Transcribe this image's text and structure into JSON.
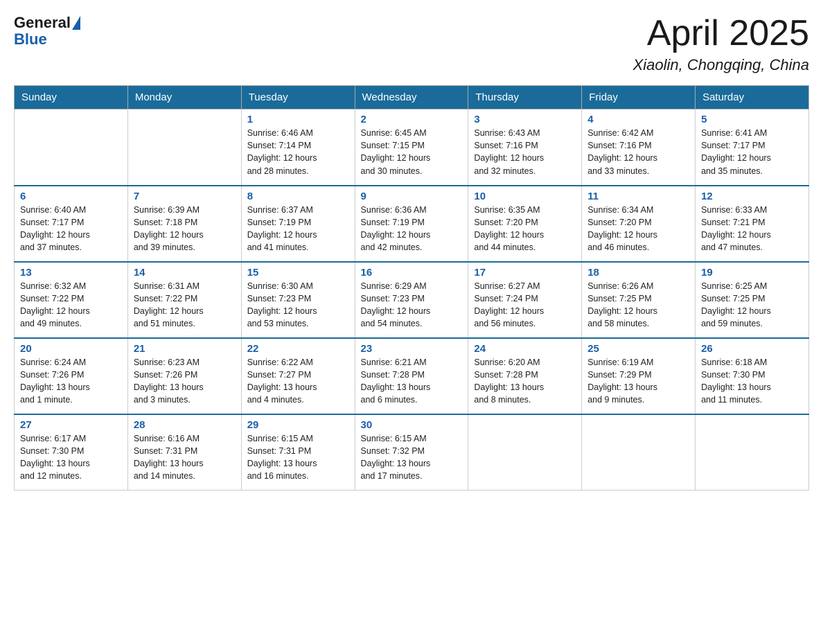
{
  "logo": {
    "general": "General",
    "blue": "Blue"
  },
  "title": {
    "month_year": "April 2025",
    "location": "Xiaolin, Chongqing, China"
  },
  "weekdays": [
    "Sunday",
    "Monday",
    "Tuesday",
    "Wednesday",
    "Thursday",
    "Friday",
    "Saturday"
  ],
  "weeks": [
    [
      {
        "day": "",
        "info": ""
      },
      {
        "day": "",
        "info": ""
      },
      {
        "day": "1",
        "info": "Sunrise: 6:46 AM\nSunset: 7:14 PM\nDaylight: 12 hours\nand 28 minutes."
      },
      {
        "day": "2",
        "info": "Sunrise: 6:45 AM\nSunset: 7:15 PM\nDaylight: 12 hours\nand 30 minutes."
      },
      {
        "day": "3",
        "info": "Sunrise: 6:43 AM\nSunset: 7:16 PM\nDaylight: 12 hours\nand 32 minutes."
      },
      {
        "day": "4",
        "info": "Sunrise: 6:42 AM\nSunset: 7:16 PM\nDaylight: 12 hours\nand 33 minutes."
      },
      {
        "day": "5",
        "info": "Sunrise: 6:41 AM\nSunset: 7:17 PM\nDaylight: 12 hours\nand 35 minutes."
      }
    ],
    [
      {
        "day": "6",
        "info": "Sunrise: 6:40 AM\nSunset: 7:17 PM\nDaylight: 12 hours\nand 37 minutes."
      },
      {
        "day": "7",
        "info": "Sunrise: 6:39 AM\nSunset: 7:18 PM\nDaylight: 12 hours\nand 39 minutes."
      },
      {
        "day": "8",
        "info": "Sunrise: 6:37 AM\nSunset: 7:19 PM\nDaylight: 12 hours\nand 41 minutes."
      },
      {
        "day": "9",
        "info": "Sunrise: 6:36 AM\nSunset: 7:19 PM\nDaylight: 12 hours\nand 42 minutes."
      },
      {
        "day": "10",
        "info": "Sunrise: 6:35 AM\nSunset: 7:20 PM\nDaylight: 12 hours\nand 44 minutes."
      },
      {
        "day": "11",
        "info": "Sunrise: 6:34 AM\nSunset: 7:20 PM\nDaylight: 12 hours\nand 46 minutes."
      },
      {
        "day": "12",
        "info": "Sunrise: 6:33 AM\nSunset: 7:21 PM\nDaylight: 12 hours\nand 47 minutes."
      }
    ],
    [
      {
        "day": "13",
        "info": "Sunrise: 6:32 AM\nSunset: 7:22 PM\nDaylight: 12 hours\nand 49 minutes."
      },
      {
        "day": "14",
        "info": "Sunrise: 6:31 AM\nSunset: 7:22 PM\nDaylight: 12 hours\nand 51 minutes."
      },
      {
        "day": "15",
        "info": "Sunrise: 6:30 AM\nSunset: 7:23 PM\nDaylight: 12 hours\nand 53 minutes."
      },
      {
        "day": "16",
        "info": "Sunrise: 6:29 AM\nSunset: 7:23 PM\nDaylight: 12 hours\nand 54 minutes."
      },
      {
        "day": "17",
        "info": "Sunrise: 6:27 AM\nSunset: 7:24 PM\nDaylight: 12 hours\nand 56 minutes."
      },
      {
        "day": "18",
        "info": "Sunrise: 6:26 AM\nSunset: 7:25 PM\nDaylight: 12 hours\nand 58 minutes."
      },
      {
        "day": "19",
        "info": "Sunrise: 6:25 AM\nSunset: 7:25 PM\nDaylight: 12 hours\nand 59 minutes."
      }
    ],
    [
      {
        "day": "20",
        "info": "Sunrise: 6:24 AM\nSunset: 7:26 PM\nDaylight: 13 hours\nand 1 minute."
      },
      {
        "day": "21",
        "info": "Sunrise: 6:23 AM\nSunset: 7:26 PM\nDaylight: 13 hours\nand 3 minutes."
      },
      {
        "day": "22",
        "info": "Sunrise: 6:22 AM\nSunset: 7:27 PM\nDaylight: 13 hours\nand 4 minutes."
      },
      {
        "day": "23",
        "info": "Sunrise: 6:21 AM\nSunset: 7:28 PM\nDaylight: 13 hours\nand 6 minutes."
      },
      {
        "day": "24",
        "info": "Sunrise: 6:20 AM\nSunset: 7:28 PM\nDaylight: 13 hours\nand 8 minutes."
      },
      {
        "day": "25",
        "info": "Sunrise: 6:19 AM\nSunset: 7:29 PM\nDaylight: 13 hours\nand 9 minutes."
      },
      {
        "day": "26",
        "info": "Sunrise: 6:18 AM\nSunset: 7:30 PM\nDaylight: 13 hours\nand 11 minutes."
      }
    ],
    [
      {
        "day": "27",
        "info": "Sunrise: 6:17 AM\nSunset: 7:30 PM\nDaylight: 13 hours\nand 12 minutes."
      },
      {
        "day": "28",
        "info": "Sunrise: 6:16 AM\nSunset: 7:31 PM\nDaylight: 13 hours\nand 14 minutes."
      },
      {
        "day": "29",
        "info": "Sunrise: 6:15 AM\nSunset: 7:31 PM\nDaylight: 13 hours\nand 16 minutes."
      },
      {
        "day": "30",
        "info": "Sunrise: 6:15 AM\nSunset: 7:32 PM\nDaylight: 13 hours\nand 17 minutes."
      },
      {
        "day": "",
        "info": ""
      },
      {
        "day": "",
        "info": ""
      },
      {
        "day": "",
        "info": ""
      }
    ]
  ]
}
